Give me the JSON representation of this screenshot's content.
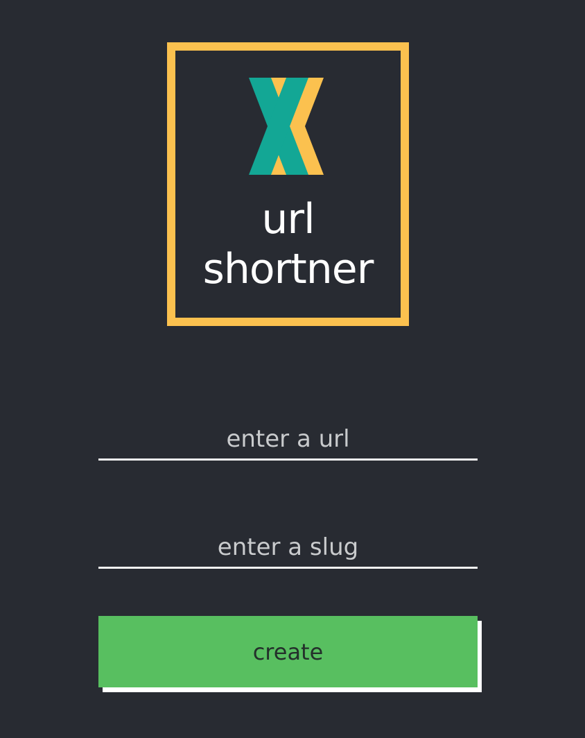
{
  "logo": {
    "word_1": "url",
    "word_2": "shortner",
    "icon": "x-mark-icon",
    "frame_color": "#fbc14f",
    "x_colors": [
      "#13a795",
      "#fbc14f"
    ]
  },
  "form": {
    "url_placeholder": "enter a url",
    "slug_placeholder": "enter a slug",
    "create_label": "create"
  },
  "colors": {
    "background": "#282b32",
    "button": "#58bf60",
    "underline": "#f4f4f4"
  }
}
